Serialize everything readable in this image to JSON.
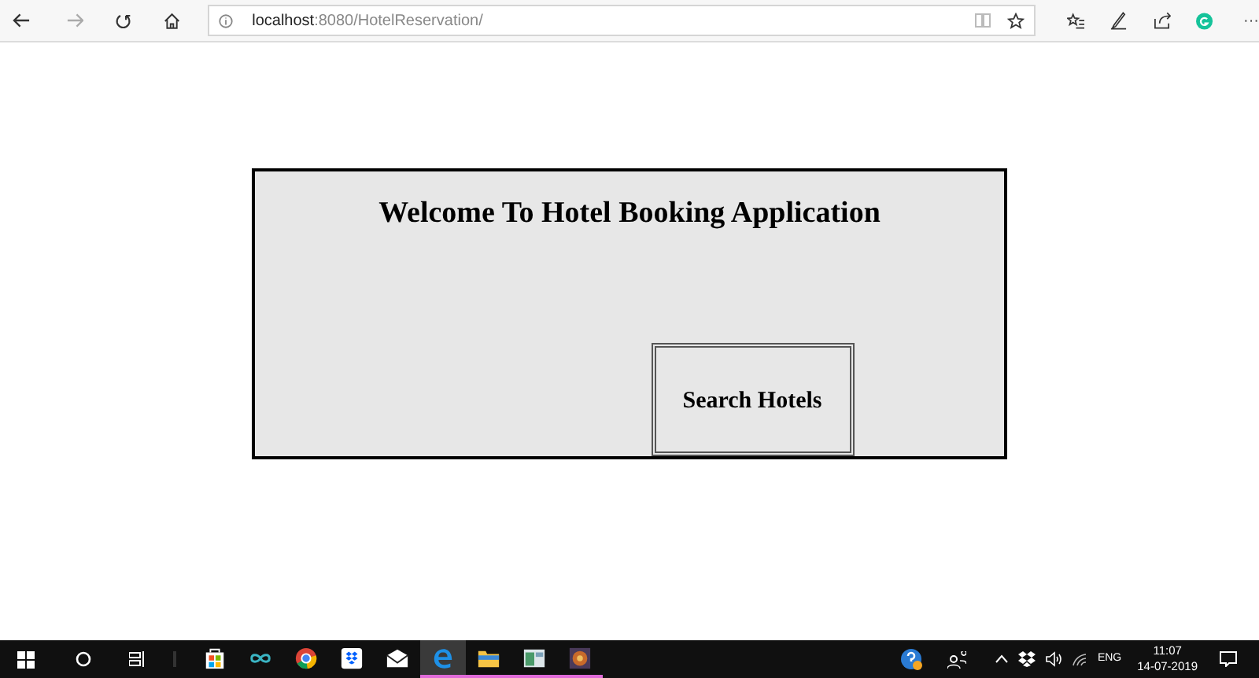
{
  "browser": {
    "url_host": "localhost",
    "url_path": ":8080/HotelReservation/",
    "more": "···"
  },
  "panel": {
    "title": "Welcome To Hotel Booking Application",
    "button": "Search Hotels"
  },
  "taskbar": {
    "apps": [
      {
        "kind": "store",
        "running": false,
        "selected": false
      },
      {
        "kind": "infinity",
        "running": false,
        "selected": false
      },
      {
        "kind": "chrome",
        "running": false,
        "selected": false
      },
      {
        "kind": "dropbox",
        "running": false,
        "selected": false
      },
      {
        "kind": "mail",
        "running": false,
        "selected": false
      },
      {
        "kind": "edge",
        "running": true,
        "selected": true
      },
      {
        "kind": "folder",
        "running": true,
        "selected": false
      },
      {
        "kind": "window",
        "running": true,
        "selected": false
      },
      {
        "kind": "game",
        "running": true,
        "selected": false
      }
    ],
    "language": "ENG",
    "time": "11:07",
    "date": "14-07-2019"
  }
}
